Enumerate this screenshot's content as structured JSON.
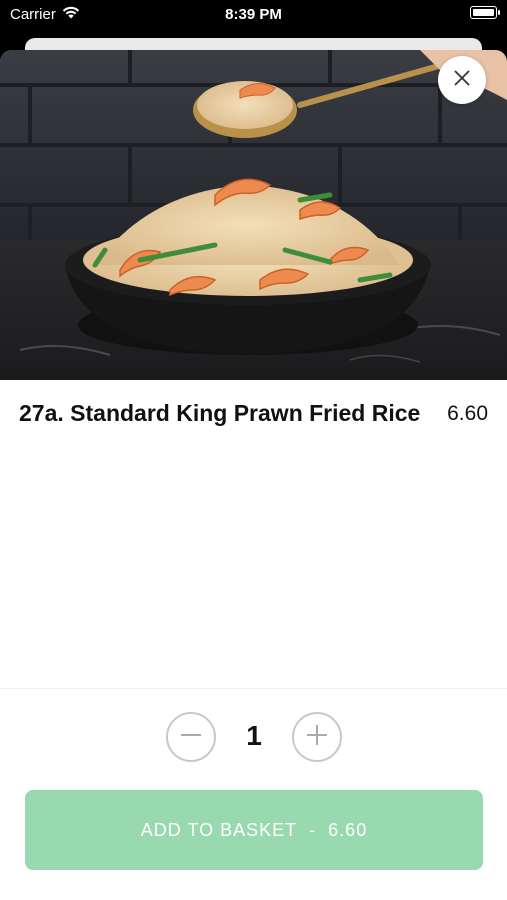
{
  "status_bar": {
    "carrier": "Carrier",
    "time": "8:39 PM",
    "wifi_icon": "wifi-icon",
    "battery_icon": "battery-icon"
  },
  "item": {
    "title": "27a. Standard King Prawn Fried Rice",
    "price": "6.60",
    "image_icon": "fried-rice-photo"
  },
  "quantity": {
    "value": "1",
    "minus_icon": "minus-circle-icon",
    "plus_icon": "plus-circle-icon"
  },
  "add_button": {
    "label": "ADD TO BASKET",
    "separator": "-",
    "price": "6.60",
    "color": "#98d9b0"
  },
  "close_icon": "close-icon"
}
